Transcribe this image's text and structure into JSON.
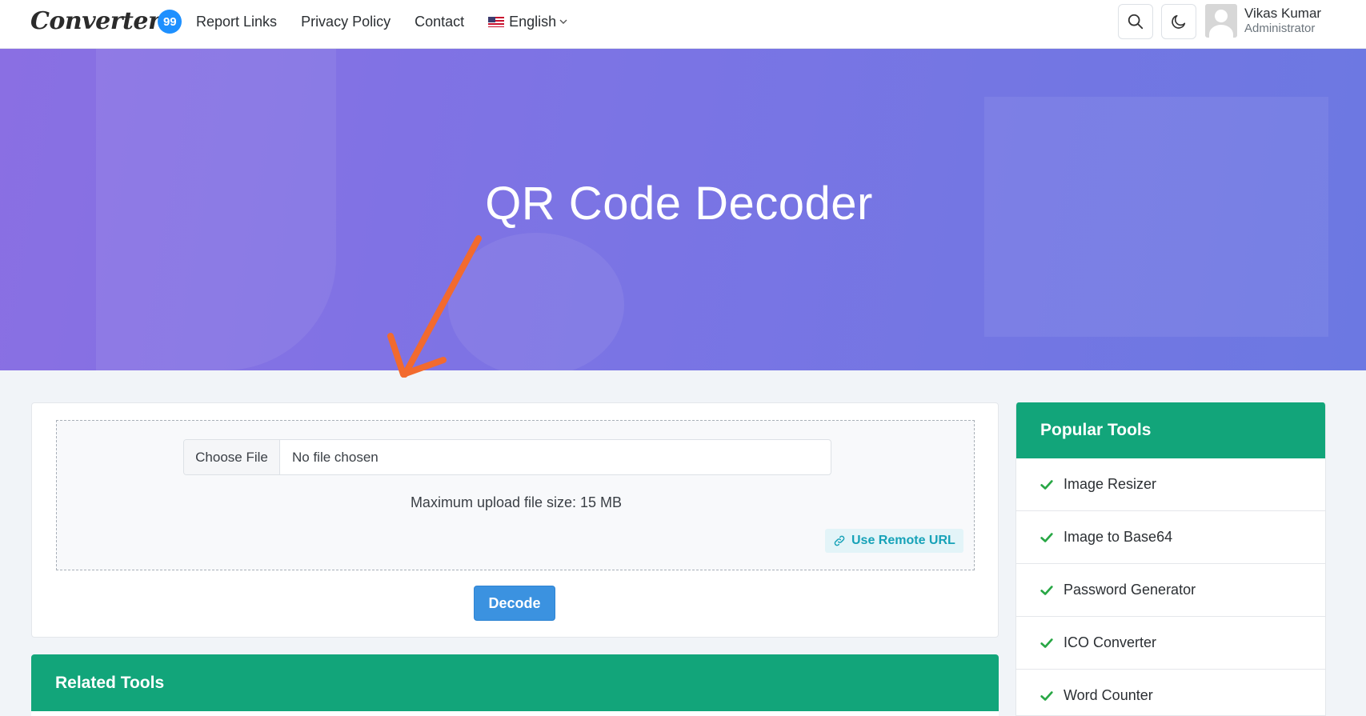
{
  "header": {
    "logo_text": "Converter",
    "logo_badge": "99",
    "nav": [
      "Report Links",
      "Privacy Policy",
      "Contact"
    ],
    "language": "English",
    "user_name": "Vikas Kumar",
    "user_role": "Administrator",
    "icons": {
      "search": "search-icon",
      "theme": "moon-icon",
      "language_flag": "us-flag-icon"
    }
  },
  "hero": {
    "title": "QR Code Decoder",
    "gradient": [
      "#8a6fe3",
      "#6c78e2"
    ]
  },
  "upload": {
    "choose_file_label": "Choose File",
    "file_status": "No file chosen",
    "max_size_text": "Maximum upload file size: 15 MB",
    "remote_url_label": "Use Remote URL",
    "decode_label": "Decode"
  },
  "related": {
    "title": "Related Tools"
  },
  "popular": {
    "title": "Popular Tools",
    "items": [
      "Image Resizer",
      "Image to Base64",
      "Password Generator",
      "ICO Converter",
      "Word Counter"
    ]
  },
  "colors": {
    "accent_green": "#12a57a",
    "button_blue": "#3b92e0",
    "check_green": "#28a745",
    "annotation_arrow": "#f26a2e"
  }
}
